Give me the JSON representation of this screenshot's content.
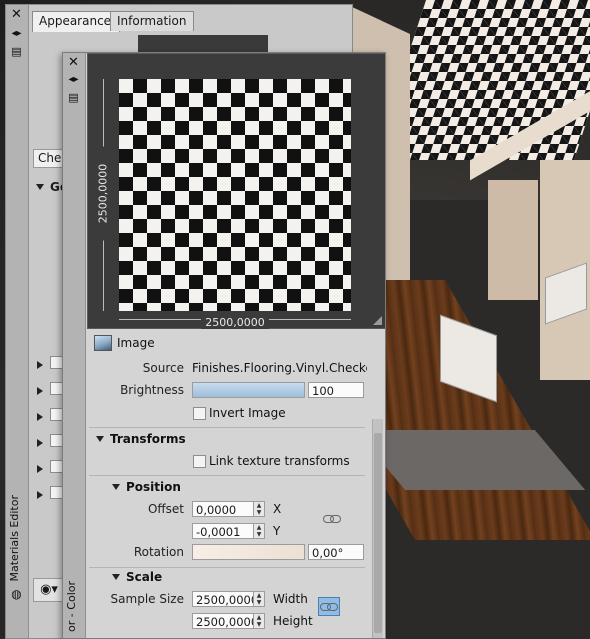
{
  "materials_editor": {
    "title": "Materials Editor",
    "tabs": [
      "Appearance",
      "Information"
    ],
    "dropdown_value": "Chec",
    "section_collapsed": "Ge"
  },
  "texture_editor": {
    "title": "or - Color",
    "preview": {
      "width_label": "2500,0000",
      "height_label": "2500,0000"
    },
    "image_section": {
      "label": "Image"
    },
    "source": {
      "label": "Source",
      "value": "Finishes.Flooring.Vinyl.Checker.B"
    },
    "brightness": {
      "label": "Brightness",
      "value": "100",
      "level_percent": 100
    },
    "invert_image": {
      "label": "Invert Image",
      "checked": false
    },
    "transforms": {
      "label": "Transforms",
      "link_texture_transforms": {
        "label": "Link texture transforms",
        "checked": false
      }
    },
    "position": {
      "label": "Position",
      "offset_label": "Offset",
      "offset_x": "0,0000",
      "offset_y": "-0,0001",
      "x_label": "X",
      "y_label": "Y",
      "rotation_label": "Rotation",
      "rotation_value": "0,00°"
    },
    "scale": {
      "label": "Scale",
      "sample_size_label": "Sample Size",
      "width_value": "2500,0000",
      "height_value": "2500,0000",
      "width_label": "Width",
      "height_label": "Height"
    }
  },
  "icons": {
    "close": "close-icon",
    "autohide": "autohide-icon",
    "properties": "properties-icon",
    "image": "image-icon",
    "link": "chain-link-icon"
  },
  "colors": {
    "panel_bg": "#d4d4d4",
    "preview_bg": "#3b3b3b",
    "link_button_active": "#7fb4e6"
  }
}
